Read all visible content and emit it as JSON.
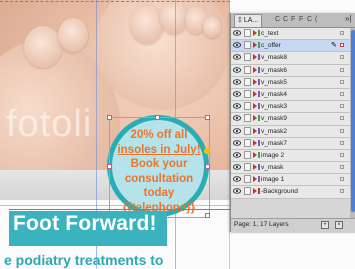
{
  "canvas": {
    "watermark": "fotoli",
    "badge": {
      "lines": [
        "20% off all",
        "insoles in July!",
        "Book your",
        "consultation today",
        "{{telephone}}"
      ]
    },
    "banner_title": "Foot Forward!",
    "subline": "e podiatry treatments to"
  },
  "layers_panel": {
    "tab_label": "‡ LA...",
    "mini_tabs": [
      "C",
      "C",
      "F",
      "F",
      "C",
      "("
    ],
    "menu_glyph": "»|",
    "layers": [
      {
        "name": "c_text",
        "selected": false,
        "color": "#4aa04a"
      },
      {
        "name": "c_offer",
        "selected": true,
        "color": "#4aa04a"
      },
      {
        "name": "v_mask8",
        "selected": false,
        "color": "#7a5bbd"
      },
      {
        "name": "v_mask6",
        "selected": false,
        "color": "#7a5bbd"
      },
      {
        "name": "v_mask5",
        "selected": false,
        "color": "#7a5bbd"
      },
      {
        "name": "v_mask4",
        "selected": false,
        "color": "#7a5bbd"
      },
      {
        "name": "v_mask3",
        "selected": false,
        "color": "#7a5bbd"
      },
      {
        "name": "v_mask9",
        "selected": false,
        "color": "#4aa04a"
      },
      {
        "name": "v_mask2",
        "selected": false,
        "color": "#7a5bbd"
      },
      {
        "name": "v_mask7",
        "selected": false,
        "color": "#7a5bbd"
      },
      {
        "name": "image 2",
        "selected": false,
        "color": "#4aa04a"
      },
      {
        "name": "v_mask",
        "selected": false,
        "color": "#7a5bbd"
      },
      {
        "name": "image 1",
        "selected": false,
        "color": "#7a5bbd"
      },
      {
        "name": "-Background",
        "selected": false,
        "color": "#c0392b"
      }
    ],
    "footer_text": "Page: 1, 17 Layers",
    "colors": {
      "selection": "#c6d8f2",
      "scroll_thumb": "#4d7ed4",
      "accent": "#29adb4"
    }
  }
}
